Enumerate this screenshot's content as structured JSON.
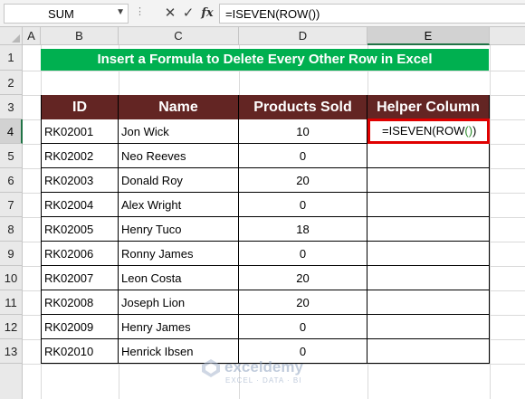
{
  "formula_bar": {
    "name_box": "SUM",
    "cancel_icon": "close-icon",
    "enter_icon": "check-icon",
    "fx_label": "fx",
    "formula": "=ISEVEN(ROW())"
  },
  "columns": [
    "A",
    "B",
    "C",
    "D",
    "E"
  ],
  "rows": [
    "1",
    "2",
    "3",
    "4",
    "5",
    "6",
    "7",
    "8",
    "9",
    "10",
    "11",
    "12",
    "13"
  ],
  "selected": {
    "column": "E",
    "row": "4"
  },
  "title": "Insert a Formula to Delete Every Other Row in Excel",
  "table": {
    "headers": [
      "ID",
      "Name",
      "Products Sold",
      "Helper Column"
    ],
    "rows": [
      {
        "id": "RK02001",
        "name": "Jon Wick",
        "sold": "10"
      },
      {
        "id": "RK02002",
        "name": "Neo Reeves",
        "sold": "0"
      },
      {
        "id": "RK02003",
        "name": "Donald Roy",
        "sold": "20"
      },
      {
        "id": "RK02004",
        "name": "Alex Wright",
        "sold": "0"
      },
      {
        "id": "RK02005",
        "name": "Henry Tuco",
        "sold": "18"
      },
      {
        "id": "RK02006",
        "name": "Ronny James",
        "sold": "0"
      },
      {
        "id": "RK02007",
        "name": "Leon Costa",
        "sold": "20"
      },
      {
        "id": "RK02008",
        "name": "Joseph Lion",
        "sold": "20"
      },
      {
        "id": "RK02009",
        "name": "Henry James",
        "sold": "0"
      },
      {
        "id": "RK02010",
        "name": "Henrick Ibsen",
        "sold": "0"
      }
    ],
    "active_cell_formula": {
      "prefix": "=ISEVEN(ROW",
      "inner_parens": "()",
      "suffix": ")"
    }
  },
  "watermark": {
    "name": "exceldemy",
    "tagline": "EXCEL · DATA · BI"
  },
  "colors": {
    "title_bg": "#00b050",
    "header_bg": "#632523",
    "active_border": "#e00000",
    "selection": "#217346"
  }
}
